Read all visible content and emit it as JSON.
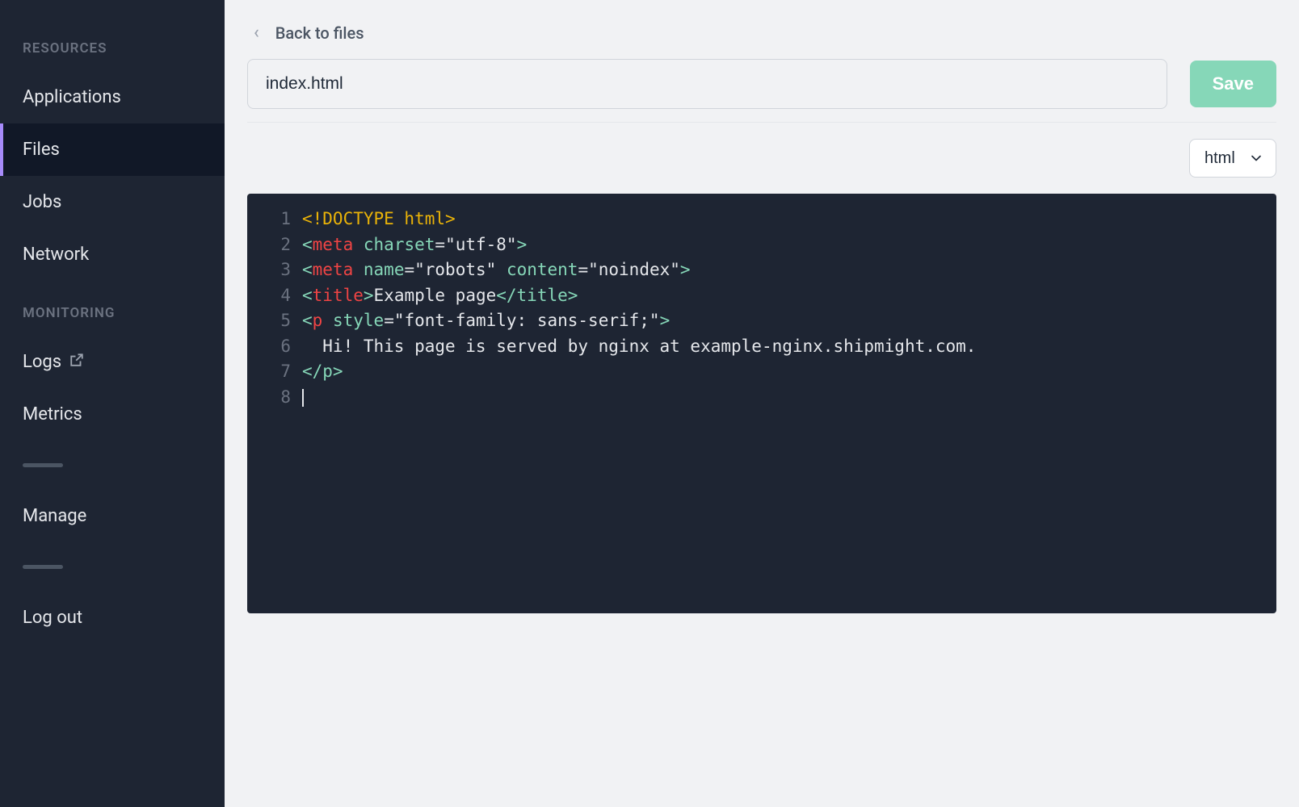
{
  "sidebar": {
    "sections": {
      "resources": {
        "header": "RESOURCES",
        "items": [
          {
            "label": "Applications",
            "active": false
          },
          {
            "label": "Files",
            "active": true
          },
          {
            "label": "Jobs",
            "active": false
          },
          {
            "label": "Network",
            "active": false
          }
        ]
      },
      "monitoring": {
        "header": "MONITORING",
        "items": [
          {
            "label": "Logs",
            "active": false,
            "external": true
          },
          {
            "label": "Metrics",
            "active": false
          }
        ]
      }
    },
    "manage": "Manage",
    "logout": "Log out"
  },
  "main": {
    "back_label": "Back to files",
    "filename": "index.html",
    "save_label": "Save",
    "language": "html",
    "code_lines": [
      {
        "num": "1",
        "tokens": [
          {
            "t": "doctype",
            "v": "<!DOCTYPE html>"
          }
        ]
      },
      {
        "num": "2",
        "tokens": [
          {
            "t": "bracket",
            "v": "<"
          },
          {
            "t": "tag",
            "v": "meta"
          },
          {
            "t": "text",
            "v": " "
          },
          {
            "t": "attr",
            "v": "charset"
          },
          {
            "t": "text",
            "v": "="
          },
          {
            "t": "string",
            "v": "\"utf-8\""
          },
          {
            "t": "bracket",
            "v": ">"
          }
        ]
      },
      {
        "num": "3",
        "tokens": [
          {
            "t": "bracket",
            "v": "<"
          },
          {
            "t": "tag",
            "v": "meta"
          },
          {
            "t": "text",
            "v": " "
          },
          {
            "t": "attr",
            "v": "name"
          },
          {
            "t": "text",
            "v": "="
          },
          {
            "t": "string",
            "v": "\"robots\""
          },
          {
            "t": "text",
            "v": " "
          },
          {
            "t": "attr",
            "v": "content"
          },
          {
            "t": "text",
            "v": "="
          },
          {
            "t": "string",
            "v": "\"noindex\""
          },
          {
            "t": "bracket",
            "v": ">"
          }
        ]
      },
      {
        "num": "4",
        "tokens": [
          {
            "t": "bracket",
            "v": "<"
          },
          {
            "t": "tag",
            "v": "title"
          },
          {
            "t": "bracket",
            "v": ">"
          },
          {
            "t": "text",
            "v": "Example page"
          },
          {
            "t": "closetag",
            "v": "</title>"
          }
        ]
      },
      {
        "num": "5",
        "tokens": [
          {
            "t": "bracket",
            "v": "<"
          },
          {
            "t": "tag",
            "v": "p"
          },
          {
            "t": "text",
            "v": " "
          },
          {
            "t": "attr",
            "v": "style"
          },
          {
            "t": "text",
            "v": "="
          },
          {
            "t": "string",
            "v": "\"font-family: sans-serif;\""
          },
          {
            "t": "bracket",
            "v": ">"
          }
        ]
      },
      {
        "num": "6",
        "tokens": [
          {
            "t": "text",
            "v": "  Hi! This page is served by nginx at example-nginx.shipmight.com."
          }
        ]
      },
      {
        "num": "7",
        "tokens": [
          {
            "t": "closetag",
            "v": "</p>"
          }
        ]
      },
      {
        "num": "8",
        "tokens": [
          {
            "t": "cursor",
            "v": ""
          }
        ]
      }
    ]
  }
}
